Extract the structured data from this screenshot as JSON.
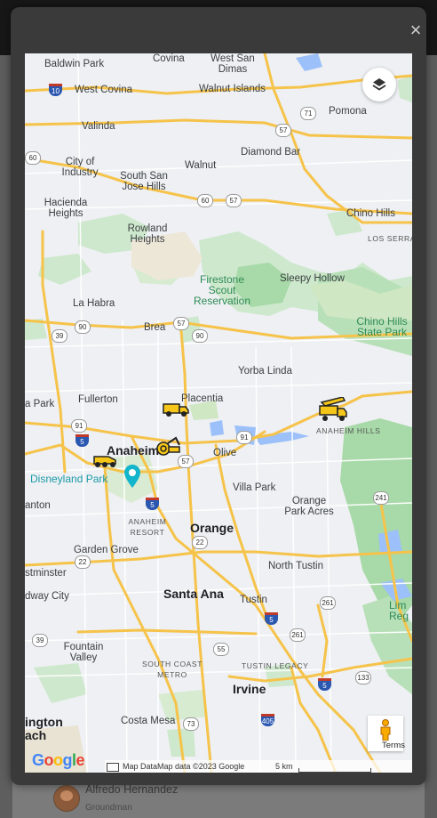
{
  "modal": {
    "close_label": "×"
  },
  "map": {
    "layers_icon": "layers-icon",
    "pegman_label": "Terms",
    "google_logo": {
      "letters": [
        "G",
        "o",
        "o",
        "g",
        "l",
        "e"
      ],
      "colors": [
        "#4285f4",
        "#ea4335",
        "#fbbc05",
        "#4285f4",
        "#34a853",
        "#ea4335"
      ]
    },
    "attribution": "Map Data",
    "attribution_full": "Map data ©2023 Google",
    "scale_label": "5 km",
    "labels": {
      "baldwin_park": "Baldwin Park",
      "covina": "Covina",
      "west_san_dimas": "West San\nDimas",
      "west_covina": "West Covina",
      "walnut_islands": "Walnut Islands",
      "pomona": "Pomona",
      "valinda": "Valinda",
      "diamond_bar": "Diamond Bar",
      "city_of_industry": "City of\nIndustry",
      "walnut": "Walnut",
      "south_san_jose_hills": "South San\nJose Hills",
      "hacienda_heights": "Hacienda\nHeights",
      "chino_hills": "Chino Hills",
      "rowland_heights": "Rowland\nHeights",
      "los_serranos": "LOS SERRA",
      "firestone": "Firestone\nScout\nReservation",
      "sleepy_hollow": "Sleepy Hollow",
      "la_habra": "La Habra",
      "chino_hills_park": "Chino Hills\nState Park",
      "brea": "Brea",
      "yorba_linda": "Yorba Linda",
      "fullerton": "Fullerton",
      "placentia": "Placentia",
      "park": "a Park",
      "anaheim": "Anaheim",
      "anaheim_hills": "ANAHEIM HILLS",
      "olive": "Olive",
      "disneyland": "Disneyland Park",
      "villa_park": "Villa Park",
      "stanton": "anton",
      "orange_park_acres": "Orange\nPark Acres",
      "anaheim_resort": "ANAHEIM\nRESORT",
      "orange": "Orange",
      "garden_grove": "Garden Grove",
      "westminster": "stminster",
      "north_tustin": "North Tustin",
      "midway_city": "dway City",
      "santa_ana": "Santa Ana",
      "tustin": "Tustin",
      "fountain_valley": "Fountain\nValley",
      "south_coast_metro": "SOUTH COAST\nMETRO",
      "tustin_legacy": "TUSTIN LEGACY",
      "irvine": "Irvine",
      "huntington_beach": "ington\nach",
      "costa_mesa": "Costa Mesa",
      "lim": "Lim\nReg"
    },
    "shields": {
      "s10": "10",
      "s60a": "60",
      "s71": "71",
      "s57a": "57",
      "s60b": "60",
      "s57b": "57",
      "s39a": "39",
      "s90a": "90",
      "s57c": "57",
      "s90b": "90",
      "s91a": "91",
      "s5a": "5",
      "s57d": "57",
      "s91b": "91",
      "s5b": "5",
      "s22a": "22",
      "s22b": "22",
      "s241": "241",
      "s39b": "39",
      "s5c": "5",
      "s261a": "261",
      "s55": "55",
      "s261b": "261",
      "s133": "133",
      "s405": "405",
      "s73": "73",
      "s5d": "5"
    },
    "vehicles": [
      "truck-icon",
      "excavator-icon",
      "roller-icon",
      "flatbed-truck-icon"
    ]
  },
  "background": {
    "person_name": "Alfredo Hernandez",
    "person_role": "Groundman"
  }
}
